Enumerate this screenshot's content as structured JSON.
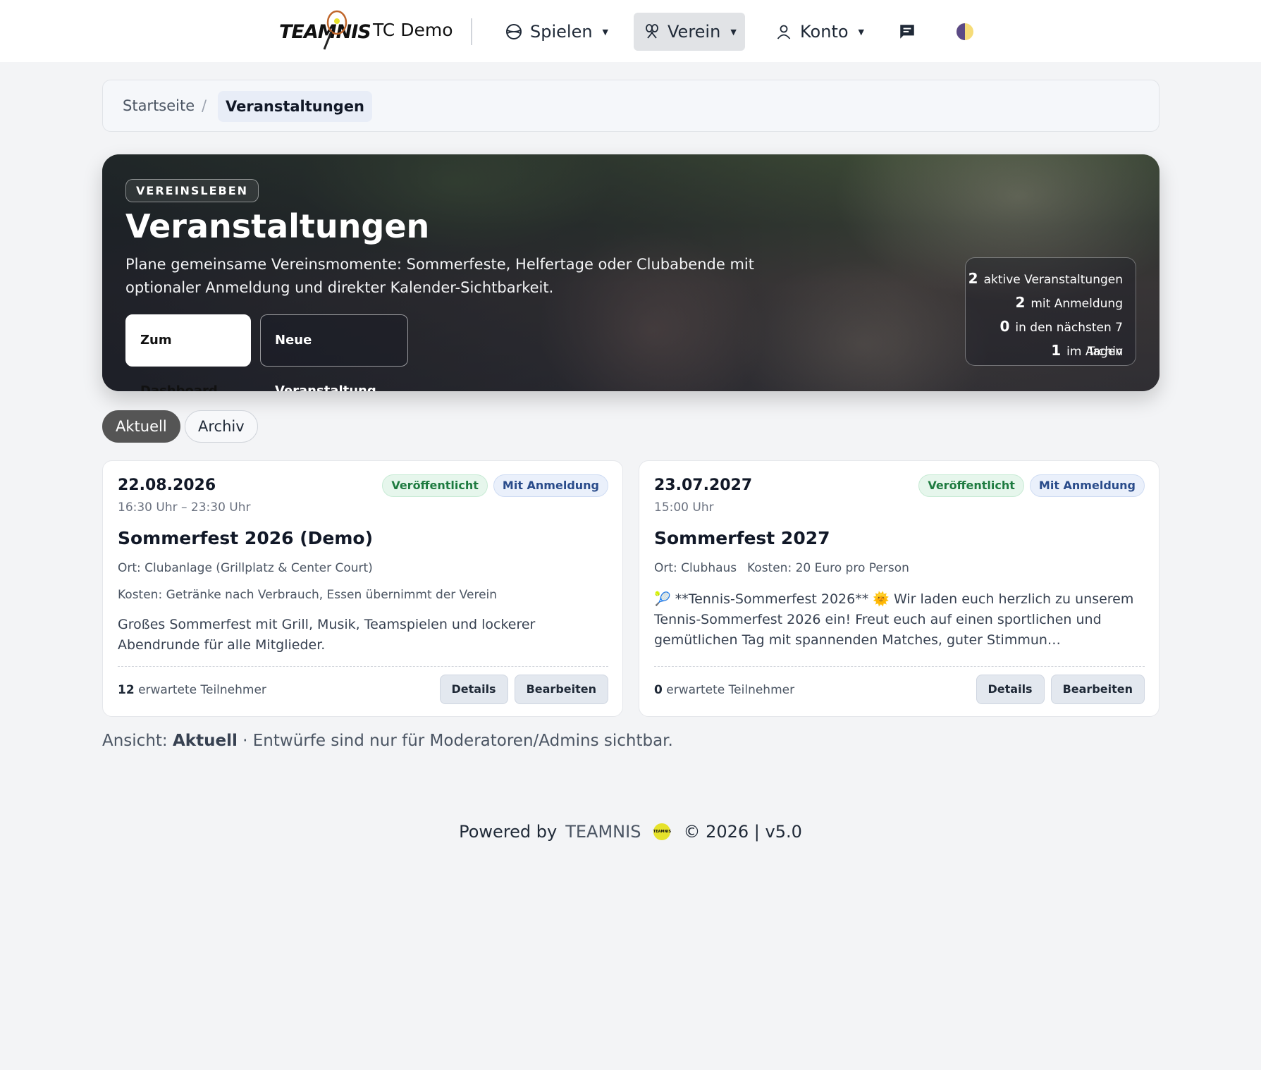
{
  "nav": {
    "logo_text": "TEAMNIS",
    "club_name": "TC Demo",
    "items": [
      {
        "label": "Spielen",
        "icon": "tennis-ball-icon"
      },
      {
        "label": "Verein",
        "icon": "crossed-rackets-icon"
      },
      {
        "label": "Konto",
        "icon": "user-icon"
      }
    ],
    "chat_icon": "chat-icon",
    "theme_icon": "theme-toggle-icon"
  },
  "breadcrumb": {
    "home": "Startseite",
    "separator": "/",
    "current": "Veranstaltungen"
  },
  "hero": {
    "kicker": "VEREINSLEBEN",
    "title": "Veranstaltungen",
    "subtitle": "Plane gemeinsame Vereinsmomente: Sommerfeste, Helfertage oder Clubabende mit optionaler Anmeldung und direkter Kalender-Sichtbarkeit.",
    "btn_dashboard": "Zum Dashboard",
    "btn_new": "Neue Veranstaltung",
    "stats": [
      {
        "value": "2",
        "label": "aktive Veranstaltungen"
      },
      {
        "value": "2",
        "label": "mit Anmeldung"
      },
      {
        "value": "0",
        "label": "in den nächsten 7 Tagen"
      },
      {
        "value": "1",
        "label": "im Archiv"
      }
    ]
  },
  "filters": {
    "active": "Aktuell",
    "archive": "Archiv"
  },
  "events": [
    {
      "date": "22.08.2026",
      "time": "16:30 Uhr – 23:30 Uhr",
      "badge_status": "Veröffentlicht",
      "badge_registration": "Mit Anmeldung",
      "title": "Sommerfest 2026 (Demo)",
      "location": "Ort: Clubanlage (Grillplatz & Center Court)",
      "cost": "Kosten: Getränke nach Verbrauch, Essen übernimmt der Verein",
      "description": "Großes Sommerfest mit Grill, Musik, Teamspielen und lockerer Abendrunde für alle Mitglieder.",
      "participants_count": "12",
      "participants_label": "erwartete Teilnehmer",
      "btn_details": "Details",
      "btn_edit": "Bearbeiten"
    },
    {
      "date": "23.07.2027",
      "time": "15:00 Uhr",
      "badge_status": "Veröffentlicht",
      "badge_registration": "Mit Anmeldung",
      "title": "Sommerfest 2027",
      "location": "Ort: Clubhaus",
      "cost": "Kosten: 20 Euro pro Person",
      "description": "🎾 **Tennis-Sommerfest 2026** 🌞 Wir laden euch herzlich zu unserem Tennis-Sommerfest 2026 ein! Freut euch auf einen sportlichen und gemütlichen Tag mit spannenden Matches, guter Stimmun…",
      "participants_count": "0",
      "participants_label": "erwartete Teilnehmer",
      "btn_details": "Details",
      "btn_edit": "Bearbeiten"
    }
  ],
  "view_note": {
    "prefix": "Ansicht:",
    "view": "Aktuell",
    "suffix": "· Entwürfe sind nur für Moderatoren/Admins sichtbar."
  },
  "footer": {
    "powered_by": "Powered by",
    "brand": "TEAMNIS",
    "ball_text": "TEAMNIS",
    "copyright": "© 2026 | v5.0"
  },
  "colors": {
    "page_bg": "#f3f4f6",
    "active_pill": "#555555",
    "badge_green": "#1e7b40",
    "badge_blue": "#2a4c8b"
  }
}
